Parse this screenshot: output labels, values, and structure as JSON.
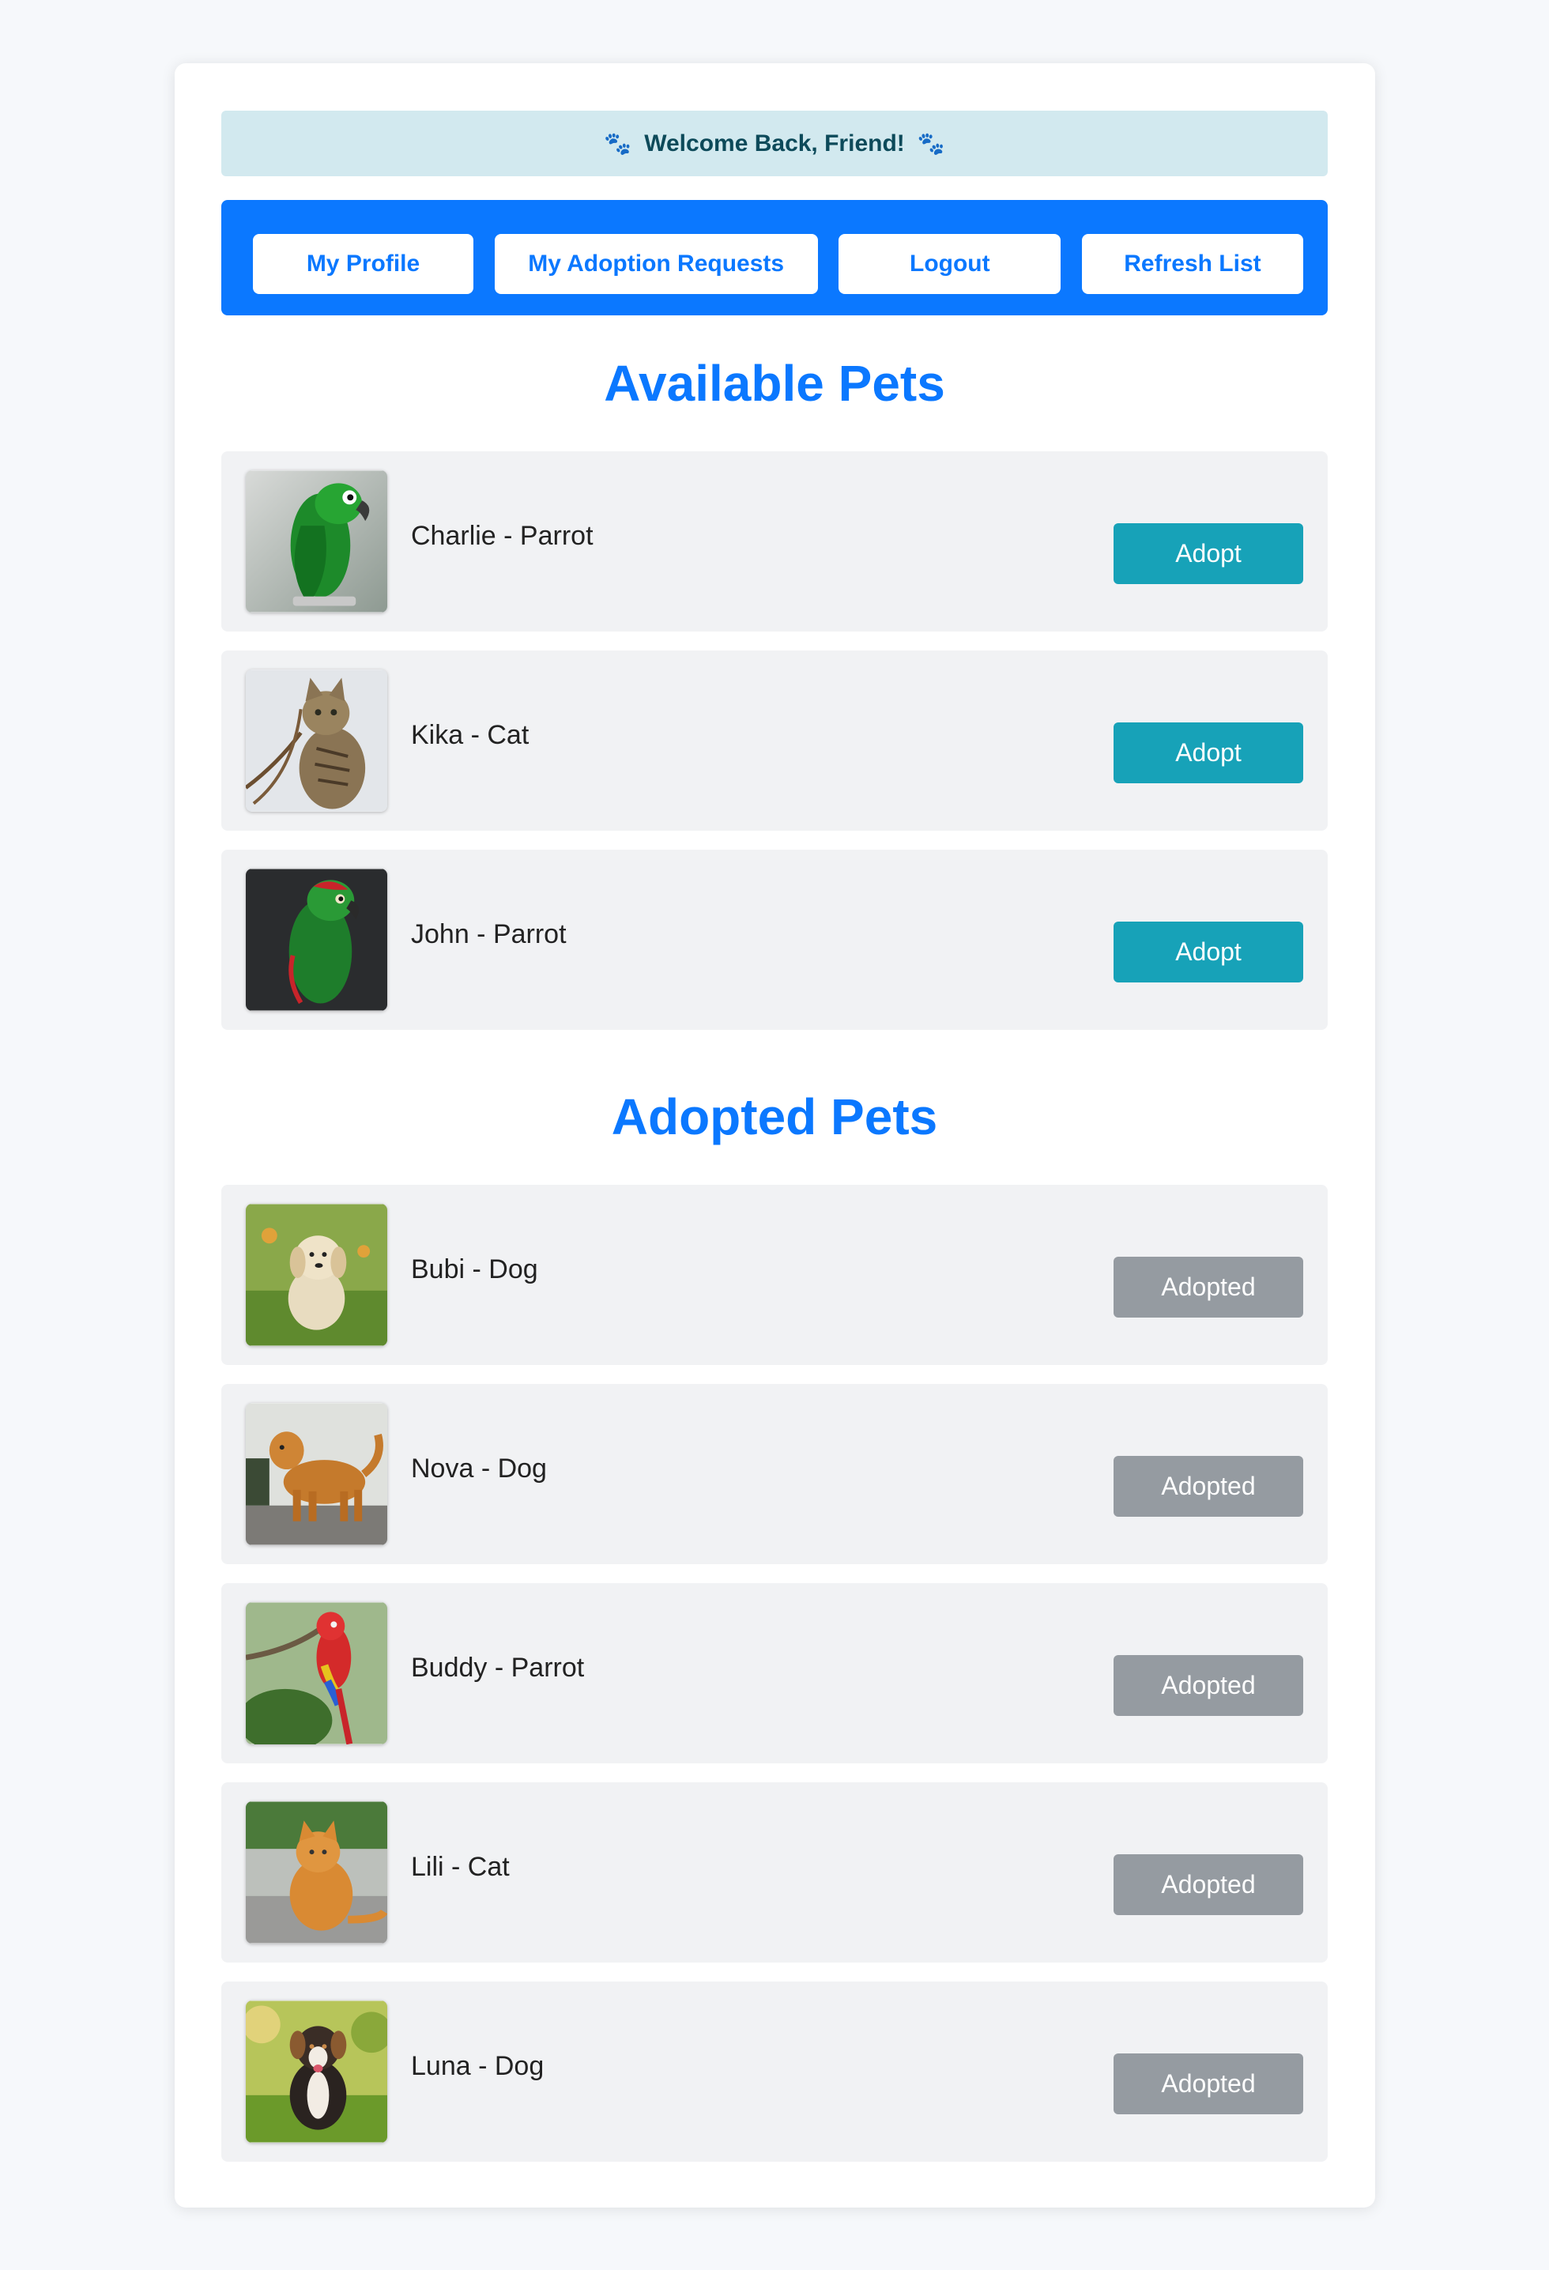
{
  "header": {
    "welcome": "Welcome Back, Friend!",
    "paw_icon": "🐾"
  },
  "nav": {
    "buttons": [
      {
        "label": "My Profile"
      },
      {
        "label": "My Adoption Requests"
      },
      {
        "label": "Logout"
      },
      {
        "label": "Refresh List"
      }
    ]
  },
  "available": {
    "title": "Available Pets",
    "pets": [
      {
        "name": "Charlie - Parrot",
        "action": "Adopt",
        "image": "green-parrot-photo"
      },
      {
        "name": "Kika - Cat",
        "action": "Adopt",
        "image": "tabby-cat-photo"
      },
      {
        "name": "John - Parrot",
        "action": "Adopt",
        "image": "green-parrot-dark-photo"
      }
    ]
  },
  "adopted": {
    "title": "Adopted Pets",
    "pets": [
      {
        "name": "Bubi - Dog",
        "action": "Adopted",
        "image": "puppy-on-grass-photo"
      },
      {
        "name": "Nova - Dog",
        "action": "Adopted",
        "image": "golden-retriever-photo"
      },
      {
        "name": "Buddy - Parrot",
        "action": "Adopted",
        "image": "scarlet-macaw-photo"
      },
      {
        "name": "Lili - Cat",
        "action": "Adopted",
        "image": "orange-cat-photo"
      },
      {
        "name": "Luna - Dog",
        "action": "Adopted",
        "image": "australian-shepherd-photo"
      }
    ]
  },
  "colors": {
    "accent": "#0b78ff",
    "adopt_button": "#17a2b8",
    "adopted_button": "#959ba1",
    "welcome_bg": "#d2e9ef",
    "row_bg": "#f1f2f4"
  }
}
